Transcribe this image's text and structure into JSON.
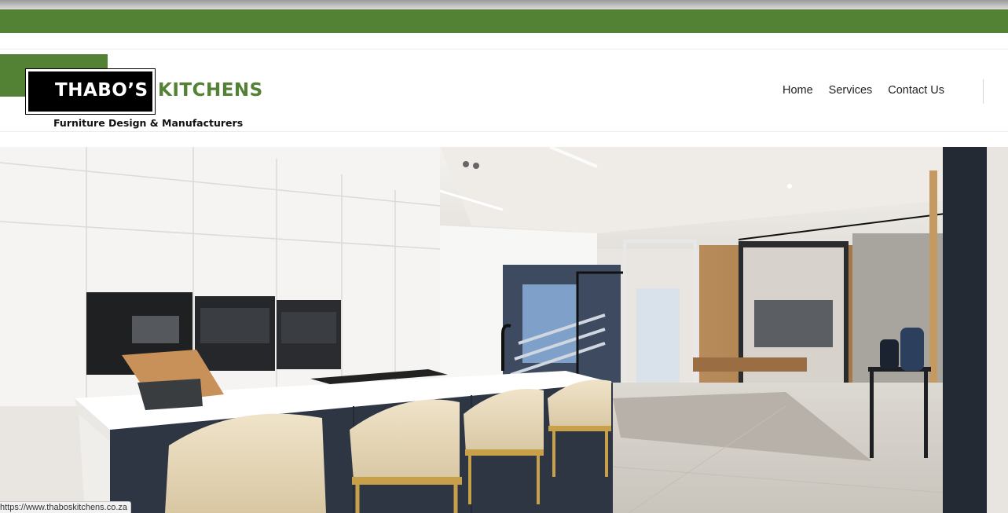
{
  "brand": {
    "name_part1": "THABO’S",
    "name_part2": "KITCHENS",
    "tagline": "Furniture Design & Manufacturers",
    "green": "#548235"
  },
  "nav": {
    "items": [
      {
        "label": "Home"
      },
      {
        "label": "Services"
      },
      {
        "label": "Contact Us"
      }
    ]
  },
  "hero": {
    "image_subject": "modern white kitchen with island, bar stools and open-plan living area"
  },
  "status_bar": {
    "url": "https://www.thaboskitchens.co.za"
  }
}
